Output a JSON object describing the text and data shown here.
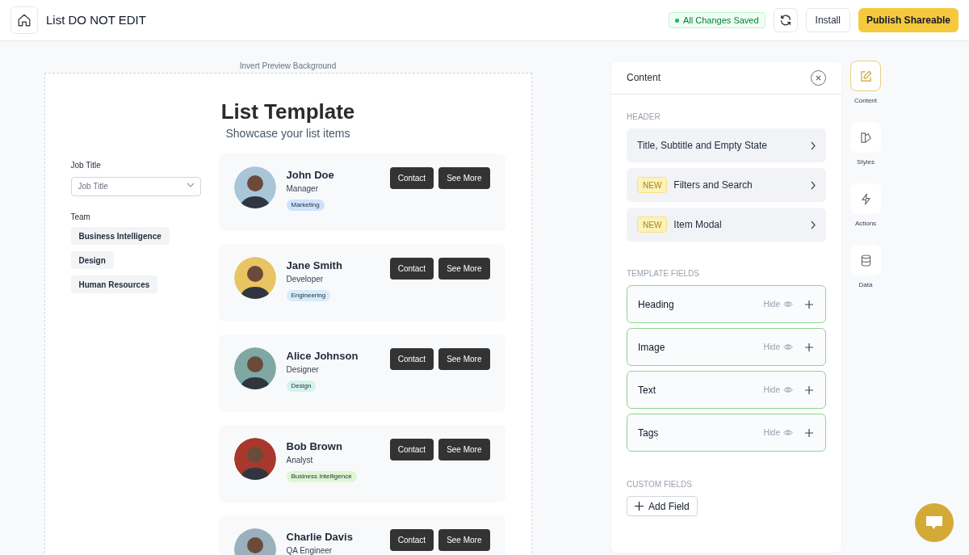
{
  "header": {
    "title": "List DO NOT EDIT",
    "save_status": "All Changes Saved",
    "buttons": [
      {
        "label": "Install",
        "kind": "outline"
      },
      {
        "label": "Publish Shareable",
        "kind": "primary"
      }
    ]
  },
  "preview": {
    "invert_label": "Invert Preview Background",
    "title": "List Template",
    "subtitle": "Showcase your list items",
    "filters": {
      "job_title": {
        "label": "Job Title",
        "placeholder": "Job Title"
      },
      "team": {
        "label": "Team",
        "options": [
          "Business Intelligence",
          "Design",
          "Human Resources"
        ]
      }
    },
    "items": [
      {
        "name": "John Doe",
        "role": "Manager",
        "color": "#a9c6d8",
        "tag": {
          "label": "Marketing",
          "color": "#cfe2fb"
        },
        "buttons": [
          "Contact",
          "See More"
        ]
      },
      {
        "name": "Jane Smith",
        "role": "Developer",
        "color": "#e9c463",
        "tag": {
          "label": "Engineering",
          "color": "#d6ecfb"
        },
        "buttons": [
          "Contact",
          "See More"
        ]
      },
      {
        "name": "Alice Johnson",
        "role": "Designer",
        "color": "#7fa8a4",
        "tag": {
          "label": "Design",
          "color": "#d3f3ec"
        },
        "buttons": [
          "Contact",
          "See More"
        ]
      },
      {
        "name": "Bob Brown",
        "role": "Analyst",
        "color": "#a8382c",
        "tag": {
          "label": "Business Intelligence",
          "color": "#dcf7d1"
        },
        "buttons": [
          "Contact",
          "See More"
        ]
      },
      {
        "name": "Charlie Davis",
        "role": "QA Engineer",
        "color": "#9ab0bd",
        "buttons": [
          "Contact",
          "See More"
        ]
      }
    ]
  },
  "panel": {
    "title": "Content",
    "sections": [
      {
        "heading": "HEADER",
        "kind": "nav",
        "items": [
          {
            "label": "Title, Subtitle and Empty State"
          },
          {
            "label": "Filters and Search",
            "badge": "NEW"
          },
          {
            "label": "Item Modal",
            "badge": "NEW"
          }
        ]
      },
      {
        "heading": "TEMPLATE FIELDS",
        "kind": "field",
        "items": [
          {
            "label": "Heading",
            "action": "Hide"
          },
          {
            "label": "Image",
            "action": "Hide"
          },
          {
            "label": "Text",
            "action": "Hide"
          },
          {
            "label": "Tags",
            "action": "Hide"
          }
        ]
      },
      {
        "heading": "CUSTOM FIELDS",
        "kind": "add",
        "button": "Add Field"
      }
    ]
  },
  "rail": [
    {
      "label": "Content",
      "selected": true
    },
    {
      "label": "Styles",
      "selected": false
    },
    {
      "label": "Actions",
      "selected": false
    },
    {
      "label": "Data",
      "selected": false
    }
  ]
}
